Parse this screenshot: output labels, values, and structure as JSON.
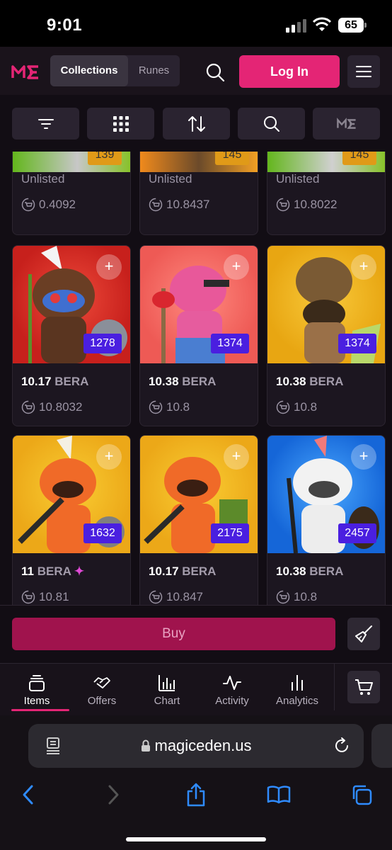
{
  "status": {
    "time": "9:01",
    "battery": "65"
  },
  "header": {
    "tabs": [
      {
        "label": "Collections",
        "active": true
      },
      {
        "label": "Runes",
        "active": false
      }
    ],
    "login_label": "Log In"
  },
  "grid": {
    "top_row": [
      {
        "badge": "139",
        "status": "Unlisted",
        "floor": "0.4092"
      },
      {
        "badge": "145",
        "status": "Unlisted",
        "floor": "10.8437"
      },
      {
        "badge": "145",
        "status": "Unlisted",
        "floor": "10.8022"
      }
    ],
    "cards": [
      {
        "badge": "1278",
        "price": "10.17",
        "unit": "BERA",
        "floor": "10.8032",
        "bg": "#d92a22"
      },
      {
        "badge": "1374",
        "price": "10.38",
        "unit": "BERA",
        "floor": "10.8",
        "bg": "#f0625e"
      },
      {
        "badge": "1374",
        "price": "10.38",
        "unit": "BERA",
        "floor": "10.8",
        "bg": "#f2b416"
      },
      {
        "badge": "1632",
        "price": "11",
        "unit": "BERA",
        "floor": "10.81",
        "bg": "#f4bb1a",
        "sparkle": "✦"
      },
      {
        "badge": "2175",
        "price": "10.17",
        "unit": "BERA",
        "floor": "10.847",
        "bg": "#f3b51c"
      },
      {
        "badge": "2457",
        "price": "10.38",
        "unit": "BERA",
        "floor": "10.8",
        "bg": "#1e7fe8"
      }
    ]
  },
  "buy_label": "Buy",
  "bottom_tabs": [
    {
      "label": "Items",
      "active": true
    },
    {
      "label": "Offers",
      "active": false
    },
    {
      "label": "Chart",
      "active": false
    },
    {
      "label": "Activity",
      "active": false
    },
    {
      "label": "Analytics",
      "active": false
    }
  ],
  "browser": {
    "url": "magiceden.us"
  },
  "colors": {
    "accent": "#e42575",
    "buy": "#a0134d",
    "badge": "#4a1fe0",
    "bg": "#120d14"
  }
}
